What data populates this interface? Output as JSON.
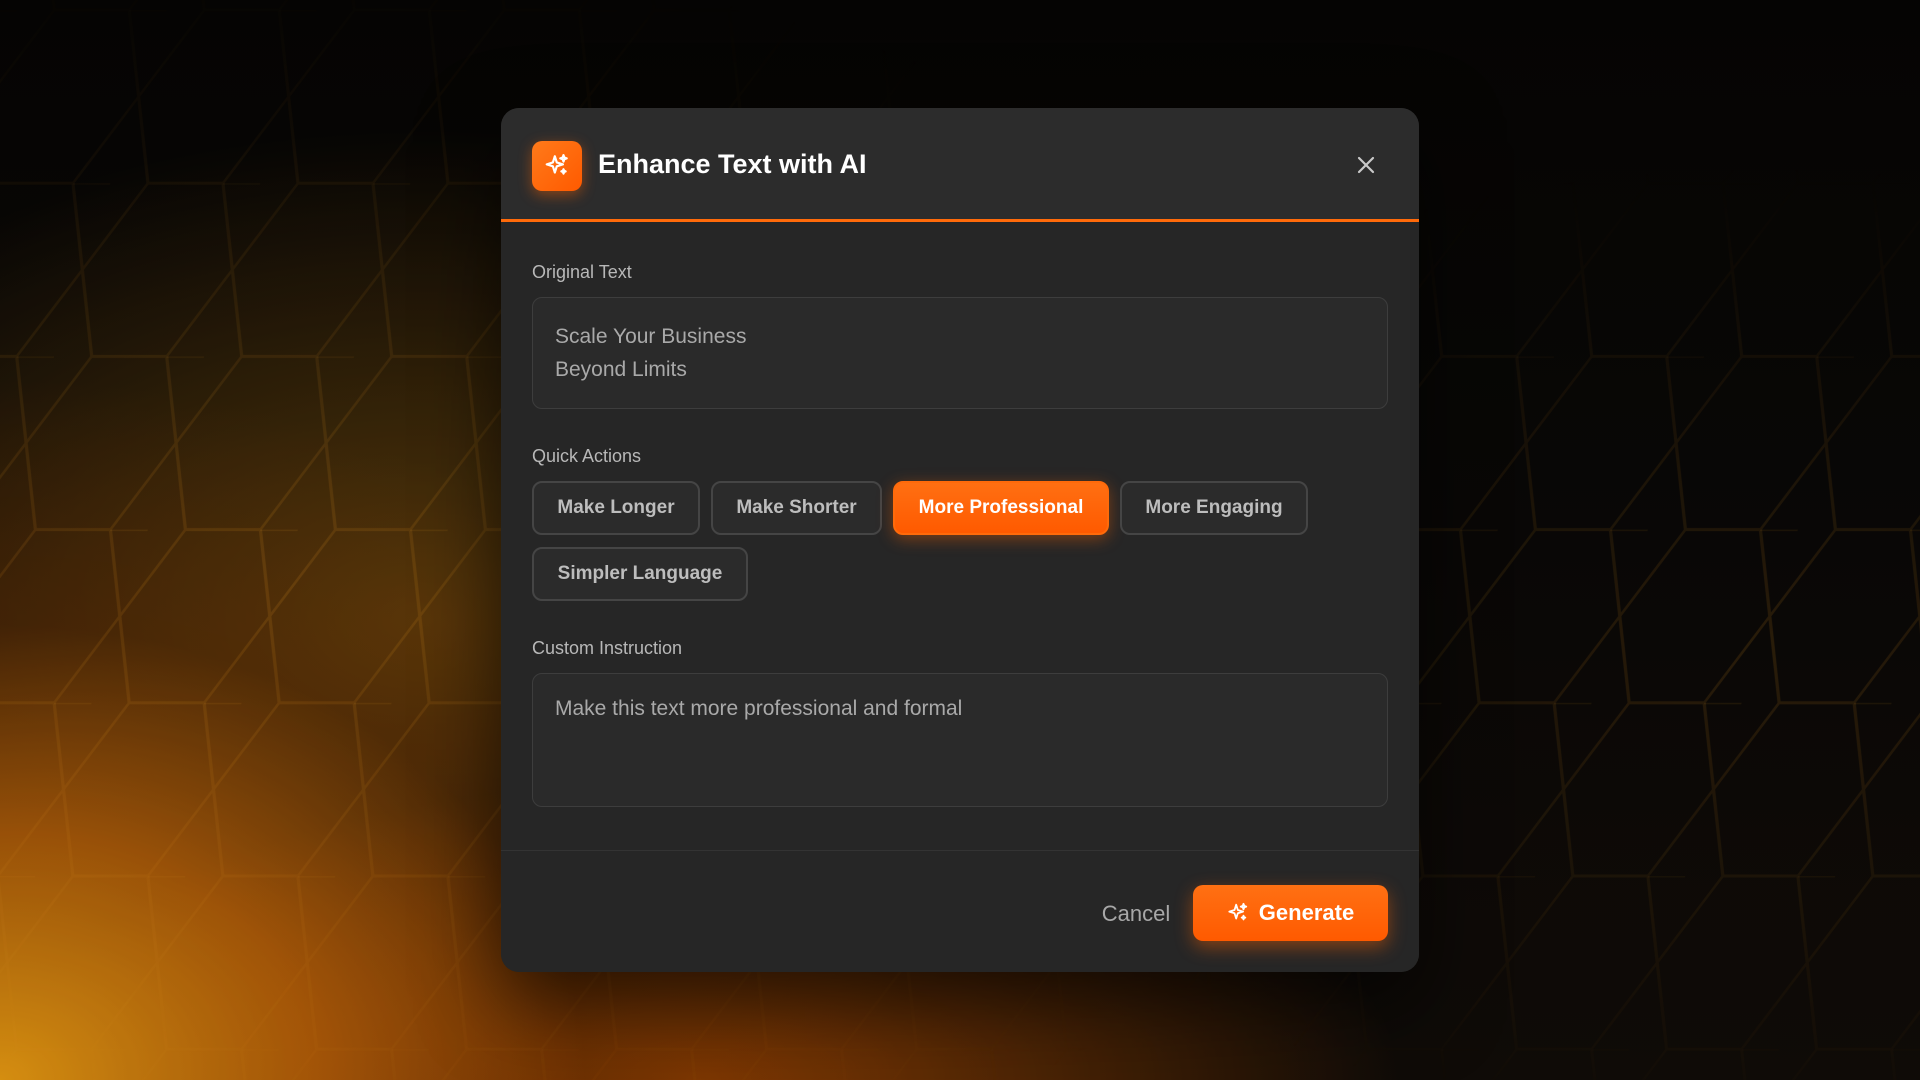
{
  "modal": {
    "title": "Enhance Text with AI",
    "header_icon": "sparkles-icon",
    "close_icon": "close-icon"
  },
  "original_text": {
    "label": "Original Text",
    "lines": [
      "Scale Your Business",
      "Beyond Limits"
    ]
  },
  "quick_actions": {
    "label": "Quick Actions",
    "chips": [
      {
        "label": "Make Longer",
        "active": false
      },
      {
        "label": "Make Shorter",
        "active": false
      },
      {
        "label": "More Professional",
        "active": true
      },
      {
        "label": "More Engaging",
        "active": false
      },
      {
        "label": "Simpler Language",
        "active": false
      }
    ]
  },
  "custom_instruction": {
    "label": "Custom Instruction",
    "value": "Make this text more professional and formal"
  },
  "footer": {
    "cancel_label": "Cancel",
    "generate_label": "Generate",
    "generate_icon": "sparkles-icon"
  },
  "colors": {
    "accent": "#ff6a0a",
    "modal_bg": "#262626",
    "header_bg": "#2c2c2c"
  }
}
